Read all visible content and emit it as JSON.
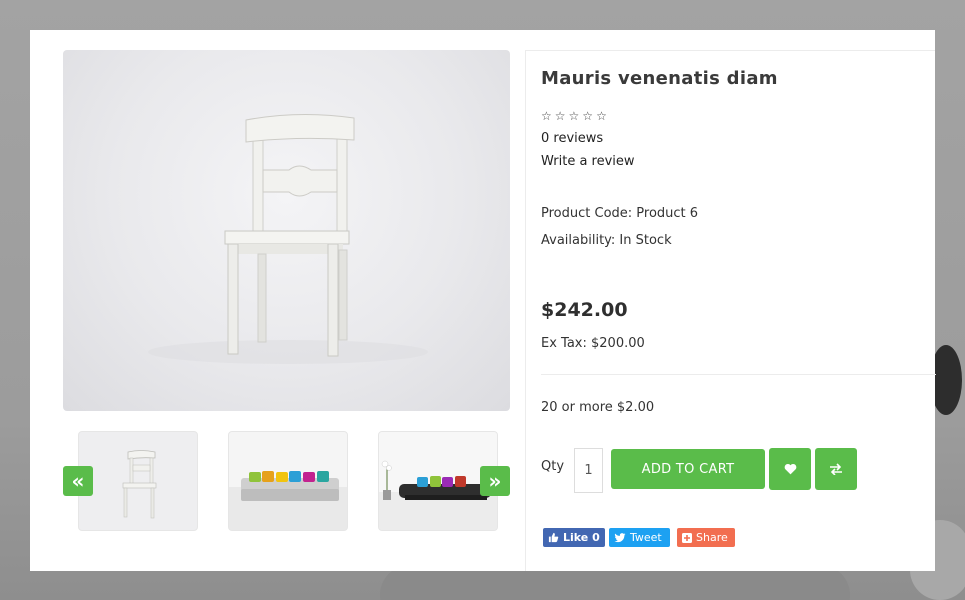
{
  "product": {
    "title": "Mauris venenatis diam",
    "rating_stars": [
      "☆",
      "☆",
      "☆",
      "☆",
      "☆"
    ],
    "reviews": "0 reviews",
    "write_review": "Write a review",
    "product_code": "Product Code: Product 6",
    "availability": "Availability: In Stock",
    "price": "$242.00",
    "ex_tax": "Ex Tax: $200.00",
    "discount": "20 or more $2.00"
  },
  "cart": {
    "qty_label": "Qty",
    "qty_value": "1",
    "add_to_cart": "ADD TO CART",
    "wishlist_icon": "heart-icon",
    "compare_icon": "exchange-icon"
  },
  "gallery": {
    "prev_icon": "double-chevron-left-icon",
    "next_icon": "double-chevron-right-icon",
    "prev_glyph": "«",
    "next_glyph": "»"
  },
  "social": {
    "facebook": "Like 0",
    "twitter": "Tweet",
    "share": "Share"
  },
  "colors": {
    "accent": "#5abc4a",
    "facebook": "#4267b2",
    "twitter": "#1da1f2",
    "share": "#f26e50"
  }
}
